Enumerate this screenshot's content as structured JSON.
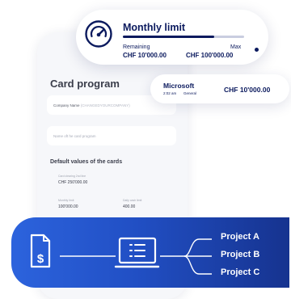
{
  "monthly_limit": {
    "title": "Monthly limit",
    "remaining_label": "Remaining",
    "remaining_value": "CHF 10'000.00",
    "max_label": "Max",
    "max_value": "CHF 100'000.00",
    "used_fraction": 0.75,
    "icon": "gauge-icon"
  },
  "transaction": {
    "merchant": "Microsoft",
    "time": "2:02 am",
    "category": "General",
    "amount": "CHF 10'000.00"
  },
  "card_program": {
    "title": "Card program",
    "company_field_label": "Company Name",
    "company_field_hint": "(CHANGEDYOURCOMPANY)",
    "name_placeholder": "Name oft he card program",
    "defaults_title": "Default values of the cards",
    "card_label": "Card clearing 2nd line",
    "card_value": "CHF 250'000.00",
    "monthly_label": "Monthly limit",
    "monthly_value": "100'000.00",
    "daily_label": "Daily cash limit",
    "daily_value": "400.00"
  },
  "flow": {
    "source_icon": "invoice-dollar-icon",
    "hub_icon": "laptop-list-icon",
    "projects": [
      "Project A",
      "Project B",
      "Project C"
    ]
  },
  "colors": {
    "navy": "#0b1a5e",
    "panel_start": "#2c63dd",
    "panel_end": "#16338f"
  }
}
